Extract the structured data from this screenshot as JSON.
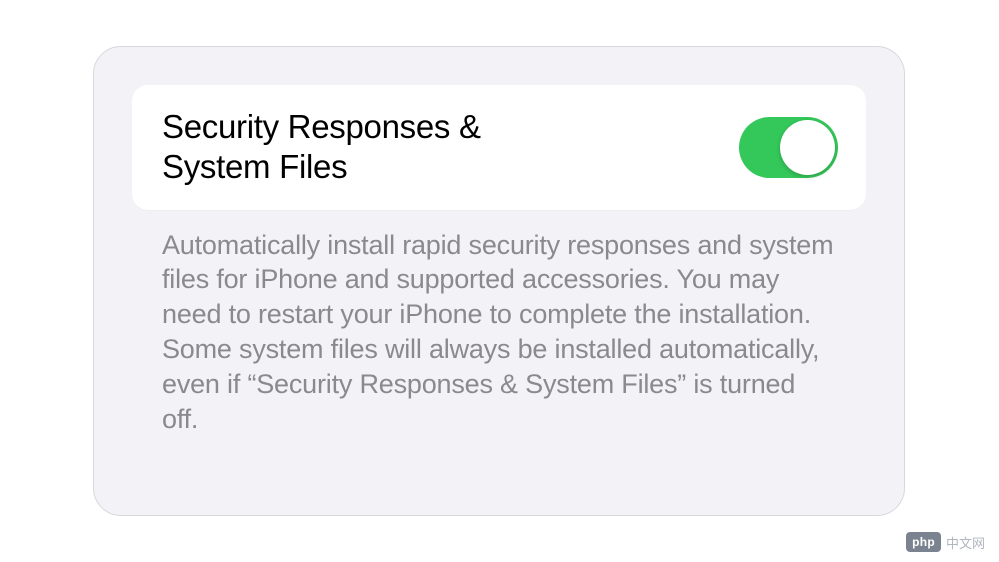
{
  "setting": {
    "title": "Security Responses & System Files",
    "toggle_state": "on",
    "description": "Automatically install rapid security responses and system files for iPhone and supported accessories. You may need to restart your iPhone to complete the installation. Some system files will always be installed automatically, even if “Security Responses & System Files” is turned off."
  },
  "watermark": {
    "badge": "php",
    "text": "中文网"
  },
  "colors": {
    "panel_bg": "#f2f2f7",
    "row_bg": "#ffffff",
    "toggle_on": "#34c759",
    "text_primary": "#000000",
    "text_secondary": "#8a8a8e"
  }
}
